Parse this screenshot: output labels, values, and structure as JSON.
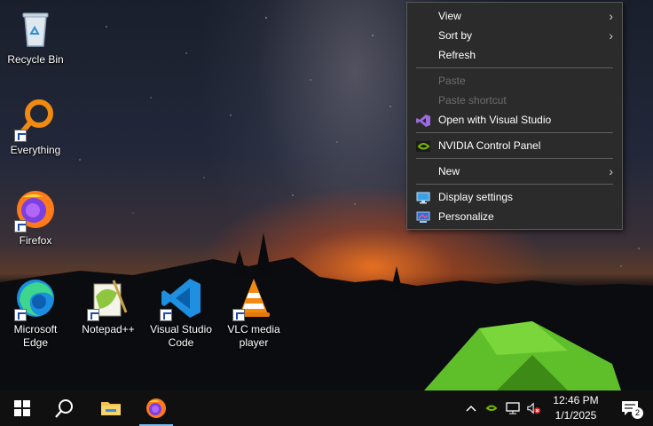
{
  "desktop": {
    "icons": [
      {
        "label": "Recycle Bin",
        "icon": "recycle-bin-icon"
      },
      {
        "label": "Everything",
        "icon": "everything-search-icon"
      },
      {
        "label": "Firefox",
        "icon": "firefox-icon"
      },
      {
        "label": "Microsoft Edge",
        "icon": "edge-icon"
      },
      {
        "label": "Notepad++",
        "icon": "notepad-plus-plus-icon"
      },
      {
        "label": "Visual Studio Code",
        "icon": "vscode-icon"
      },
      {
        "label": "VLC media player",
        "icon": "vlc-icon"
      }
    ]
  },
  "context_menu": {
    "view": "View",
    "sort_by": "Sort by",
    "refresh": "Refresh",
    "paste": "Paste",
    "paste_shortcut": "Paste shortcut",
    "open_visual_studio": "Open with Visual Studio",
    "nvidia": "NVIDIA Control Panel",
    "new": "New",
    "display_settings": "Display settings",
    "personalize": "Personalize",
    "submenu_arrow": "›"
  },
  "taskbar": {
    "time": "12:46 PM",
    "date": "1/1/2025",
    "notification_count": "2",
    "accent_color": "#76b9ed"
  }
}
